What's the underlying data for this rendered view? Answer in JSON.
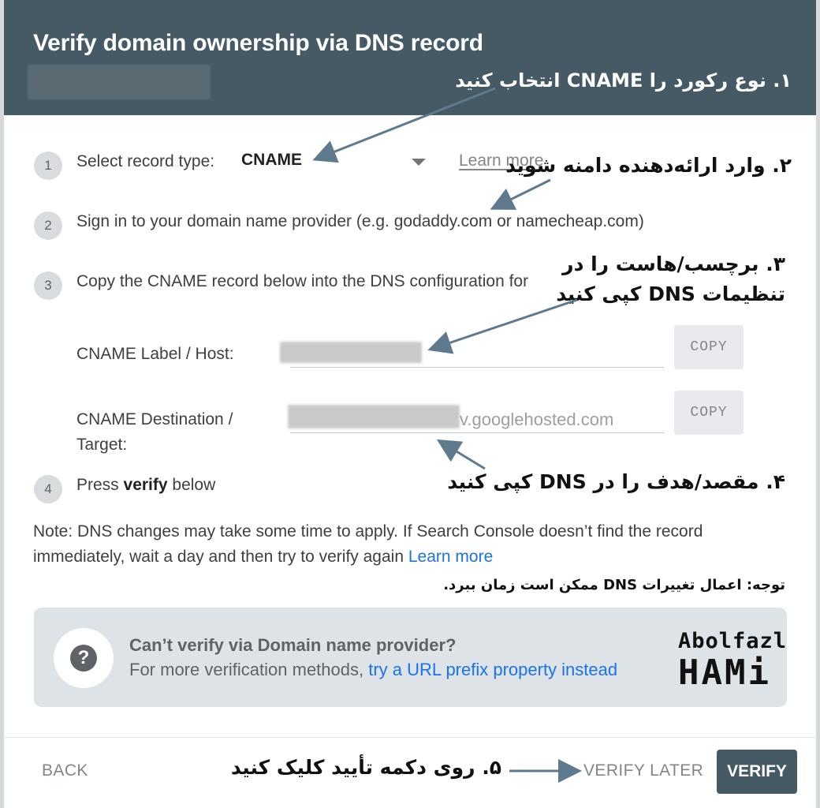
{
  "dialog": {
    "title": "Verify domain ownership via DNS record"
  },
  "steps": [
    {
      "num": "1",
      "label": "Select record type:",
      "record_type": "CNAME",
      "learn_more": "Learn more"
    },
    {
      "num": "2",
      "text": "Sign in to your domain name provider (e.g. godaddy.com or namecheap.com)"
    },
    {
      "num": "3",
      "text": "Copy the CNAME record below into the DNS configuration for"
    },
    {
      "num": "4",
      "text_pre": "Press ",
      "text_bold": "verify",
      "text_post": " below"
    }
  ],
  "record": {
    "label_host": "CNAME Label / Host:",
    "destination_line1": "CNAME Destination /",
    "destination_line2": "Target:",
    "destination_suffix": "v.googlehosted.com",
    "copy_label": "COPY"
  },
  "note": {
    "text": "Note: DNS changes may take some time to apply. If Search Console doesn’t find the record immediately, wait a day and then try to verify again",
    "link": "Learn more"
  },
  "alternative": {
    "title": "Can’t verify via Domain name provider?",
    "sub_text": "For more verification methods, ",
    "sub_link": "try a URL prefix property instead"
  },
  "footer": {
    "back": "BACK",
    "verify_later": "VERIFY LATER",
    "verify": "VERIFY"
  },
  "annotations": {
    "a1": "۱. نوع رکورد را CNAME انتخاب کنید",
    "a2": "۲. وارد ارائه‌دهنده دامنه شوید",
    "a3_line1": "۳. برچسب/هاست را در",
    "a3_line2": "تنظیمات DNS کپی کنید",
    "a4": "۴. مقصد/هدف را در DNS کپی کنید",
    "note_fa": "توجه: اعمال تغییرات DNS ممکن است زمان ببرد.",
    "a5": "۵. روی دکمه تأیید کلیک کنید"
  },
  "logo": {
    "line1": "Abolfazl",
    "line2": "HAMi"
  },
  "colors": {
    "header": "#455a64",
    "link": "#1a73e8",
    "arrow": "#5e7a8c"
  }
}
